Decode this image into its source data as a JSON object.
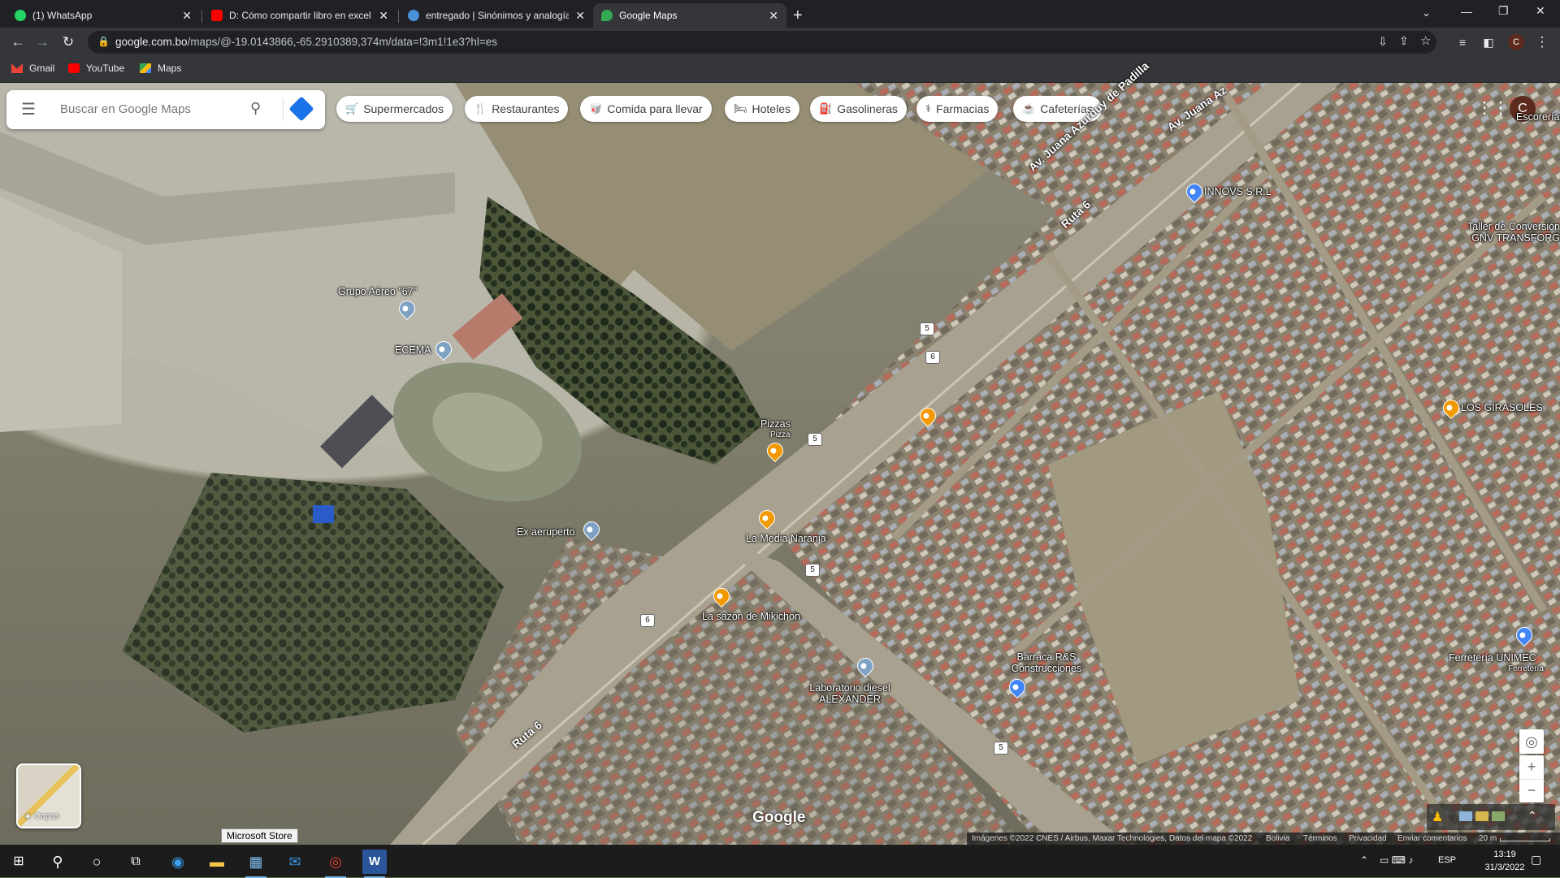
{
  "browser": {
    "tabs": [
      {
        "title": "(1) WhatsApp",
        "icon": "whatsapp-icon",
        "color": "#25d366"
      },
      {
        "title": "D: Cómo compartir libro en excel",
        "icon": "youtube-icon",
        "color": "#ff0000"
      },
      {
        "title": "entregado | Sinónimos y analogías",
        "icon": "dictionary-icon",
        "color": "#4a90d9"
      },
      {
        "title": "Google Maps",
        "icon": "google-maps-icon",
        "color": "#34a853"
      }
    ],
    "new_tab": "+",
    "url_domain": "google.com.bo",
    "url_path": "/maps/@-19.0143866,-65.2910389,374m/data=!3m1!1e3?hl=es",
    "profile_initial": "C",
    "bookmarks": [
      {
        "label": "Gmail",
        "icon": "gmail-icon"
      },
      {
        "label": "YouTube",
        "icon": "youtube-icon"
      },
      {
        "label": "Maps",
        "icon": "maps-icon"
      }
    ]
  },
  "maps": {
    "search_placeholder": "Buscar en Google Maps",
    "chips": [
      {
        "label": "Supermercados",
        "icon": "cart-icon"
      },
      {
        "label": "Restaurantes",
        "icon": "restaurant-icon"
      },
      {
        "label": "Comida para llevar",
        "icon": "takeout-icon"
      },
      {
        "label": "Hoteles",
        "icon": "hotel-icon"
      },
      {
        "label": "Gasolineras",
        "icon": "gas-station-icon"
      },
      {
        "label": "Farmacias",
        "icon": "pharmacy-icon"
      },
      {
        "label": "Cafeterías",
        "icon": "coffee-icon"
      }
    ],
    "account_initial": "C",
    "places": [
      "Grupo Aéreo \"67\"",
      "ECEMA",
      "Pizzas",
      "Pizza",
      "Ex aeruperto",
      "La Media Naranja",
      "La sazón de Mikichon",
      "Laboratorio diesel ALEXANDER",
      "Barraca R&S Construcciones",
      "INNOVS S.R.L",
      "LOS GIRASOLES",
      "Ferretería UNIMEC",
      "Ferretería",
      "Taller de Conversión GNV TRANSFORG",
      "Escorería"
    ],
    "roads": [
      "Av. Juana Azurduy de Padilla",
      "Ruta 6",
      "Av. Juana Az",
      "Ruta 6"
    ],
    "shields": [
      "5",
      "6",
      "5",
      "5",
      "6",
      "6",
      "5"
    ],
    "layers_label": "Capas",
    "google_logo": "Google",
    "tooltip": "Microsoft Store",
    "footer": {
      "attribution": "Imágenes ©2022 CNES / Airbus, Maxar Technologies, Datos del mapa ©2022",
      "country": "Bolivia",
      "terms": "Términos",
      "privacy": "Privacidad",
      "feedback": "Enviar comentarios",
      "scale": "20 m"
    }
  },
  "taskbar": {
    "language": "ESP",
    "time": "13:19",
    "date": "31/3/2022"
  }
}
